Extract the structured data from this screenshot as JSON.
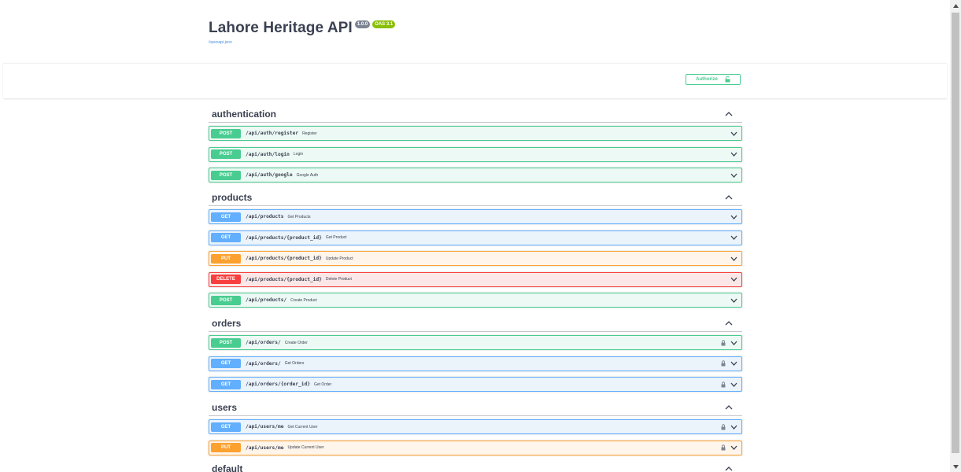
{
  "info": {
    "title": "Lahore Heritage API",
    "version": "1.0.0",
    "oas": "OAS 3.1",
    "spec_link": "/openapi.json"
  },
  "authorize": {
    "label": "Authorize",
    "icon": "unlock-icon"
  },
  "colors": {
    "post": "#49cc90",
    "get": "#61affe",
    "put": "#fca130",
    "delete": "#f93e3e"
  },
  "tags": [
    {
      "name": "authentication",
      "ops": [
        {
          "method": "POST",
          "path": "/api/auth/register",
          "summary": "Register",
          "locked": false
        },
        {
          "method": "POST",
          "path": "/api/auth/login",
          "summary": "Login",
          "locked": false
        },
        {
          "method": "POST",
          "path": "/api/auth/google",
          "summary": "Google Auth",
          "locked": false
        }
      ]
    },
    {
      "name": "products",
      "ops": [
        {
          "method": "GET",
          "path": "/api/products",
          "summary": "Get Products",
          "locked": false
        },
        {
          "method": "GET",
          "path": "/api/products/{product_id}",
          "summary": "Get Product",
          "locked": false
        },
        {
          "method": "PUT",
          "path": "/api/products/{product_id}",
          "summary": "Update Product",
          "locked": false
        },
        {
          "method": "DELETE",
          "path": "/api/products/{product_id}",
          "summary": "Delete Product",
          "locked": false
        },
        {
          "method": "POST",
          "path": "/api/products/",
          "summary": "Create Product",
          "locked": false
        }
      ]
    },
    {
      "name": "orders",
      "ops": [
        {
          "method": "POST",
          "path": "/api/orders/",
          "summary": "Create Order",
          "locked": true
        },
        {
          "method": "GET",
          "path": "/api/orders/",
          "summary": "Get Orders",
          "locked": true
        },
        {
          "method": "GET",
          "path": "/api/orders/{order_id}",
          "summary": "Get Order",
          "locked": true
        }
      ]
    },
    {
      "name": "users",
      "ops": [
        {
          "method": "GET",
          "path": "/api/users/me",
          "summary": "Get Current User",
          "locked": true
        },
        {
          "method": "PUT",
          "path": "/api/users/me",
          "summary": "Update Current User",
          "locked": true
        }
      ]
    },
    {
      "name": "default",
      "ops": []
    }
  ]
}
